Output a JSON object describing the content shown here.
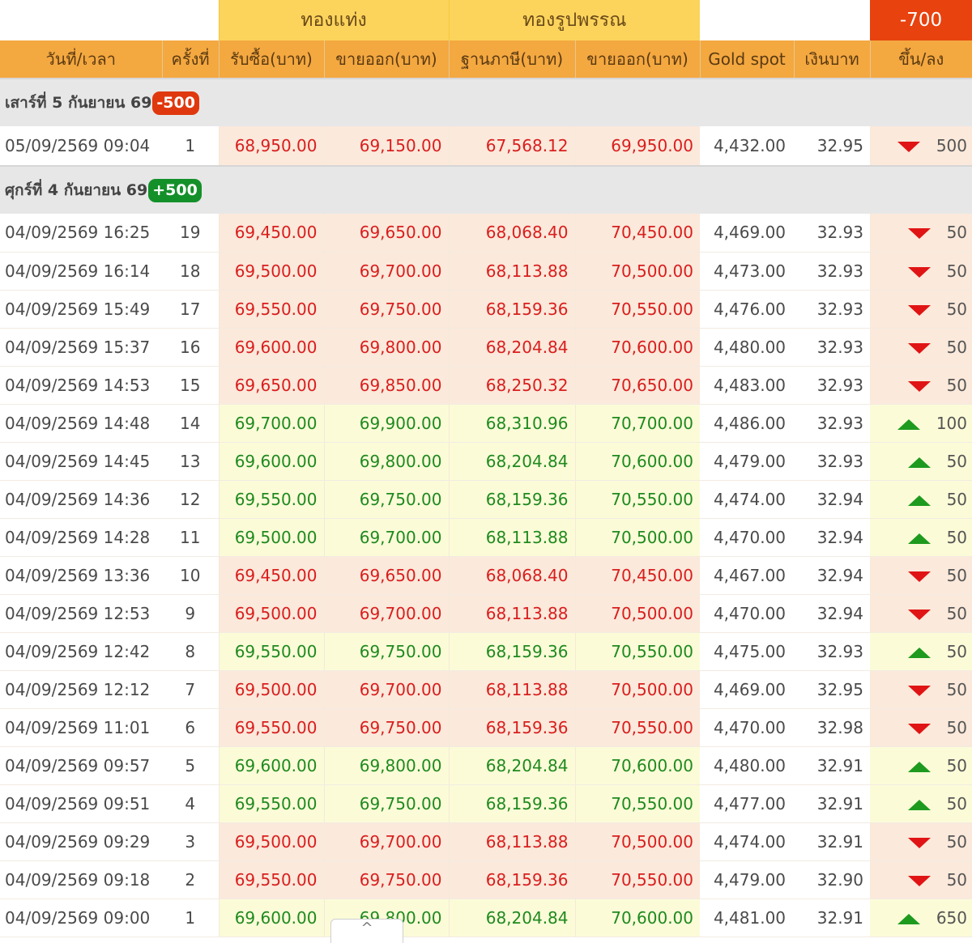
{
  "header": {
    "bar_group": "ทองแท่ง",
    "ornament_group": "ทองรูปพรรณ",
    "total_change": "-700"
  },
  "columns": [
    "วันที่/เวลา",
    "ครั้งที่",
    "รับซื้อ(บาท)",
    "ขายออก(บาท)",
    "ฐานภาษี(บาท)",
    "ขายออก(บาท)",
    "Gold spot",
    "เงินบาท",
    "ขึ้น/ลง"
  ],
  "days": [
    {
      "label": "เสาร์ที่ 5 กันยายน 69",
      "badge": "-500",
      "badge_trend": "down",
      "rows": [
        {
          "dt": "05/09/2569 09:04",
          "n": "1",
          "bar_buy": "68,950.00",
          "bar_sell": "69,150.00",
          "orn_tax": "67,568.12",
          "orn_sell": "69,950.00",
          "spot": "4,432.00",
          "thb": "32.95",
          "trend": "down",
          "change": "500"
        }
      ]
    },
    {
      "label": "ศุกร์ที่ 4 กันยายน 69",
      "badge": "+500",
      "badge_trend": "up",
      "rows": [
        {
          "dt": "04/09/2569 16:25",
          "n": "19",
          "bar_buy": "69,450.00",
          "bar_sell": "69,650.00",
          "orn_tax": "68,068.40",
          "orn_sell": "70,450.00",
          "spot": "4,469.00",
          "thb": "32.93",
          "trend": "down",
          "change": "50"
        },
        {
          "dt": "04/09/2569 16:14",
          "n": "18",
          "bar_buy": "69,500.00",
          "bar_sell": "69,700.00",
          "orn_tax": "68,113.88",
          "orn_sell": "70,500.00",
          "spot": "4,473.00",
          "thb": "32.93",
          "trend": "down",
          "change": "50"
        },
        {
          "dt": "04/09/2569 15:49",
          "n": "17",
          "bar_buy": "69,550.00",
          "bar_sell": "69,750.00",
          "orn_tax": "68,159.36",
          "orn_sell": "70,550.00",
          "spot": "4,476.00",
          "thb": "32.93",
          "trend": "down",
          "change": "50"
        },
        {
          "dt": "04/09/2569 15:37",
          "n": "16",
          "bar_buy": "69,600.00",
          "bar_sell": "69,800.00",
          "orn_tax": "68,204.84",
          "orn_sell": "70,600.00",
          "spot": "4,480.00",
          "thb": "32.93",
          "trend": "down",
          "change": "50"
        },
        {
          "dt": "04/09/2569 14:53",
          "n": "15",
          "bar_buy": "69,650.00",
          "bar_sell": "69,850.00",
          "orn_tax": "68,250.32",
          "orn_sell": "70,650.00",
          "spot": "4,483.00",
          "thb": "32.93",
          "trend": "down",
          "change": "50"
        },
        {
          "dt": "04/09/2569 14:48",
          "n": "14",
          "bar_buy": "69,700.00",
          "bar_sell": "69,900.00",
          "orn_tax": "68,310.96",
          "orn_sell": "70,700.00",
          "spot": "4,486.00",
          "thb": "32.93",
          "trend": "up",
          "change": "100"
        },
        {
          "dt": "04/09/2569 14:45",
          "n": "13",
          "bar_buy": "69,600.00",
          "bar_sell": "69,800.00",
          "orn_tax": "68,204.84",
          "orn_sell": "70,600.00",
          "spot": "4,479.00",
          "thb": "32.93",
          "trend": "up",
          "change": "50"
        },
        {
          "dt": "04/09/2569 14:36",
          "n": "12",
          "bar_buy": "69,550.00",
          "bar_sell": "69,750.00",
          "orn_tax": "68,159.36",
          "orn_sell": "70,550.00",
          "spot": "4,474.00",
          "thb": "32.94",
          "trend": "up",
          "change": "50"
        },
        {
          "dt": "04/09/2569 14:28",
          "n": "11",
          "bar_buy": "69,500.00",
          "bar_sell": "69,700.00",
          "orn_tax": "68,113.88",
          "orn_sell": "70,500.00",
          "spot": "4,470.00",
          "thb": "32.94",
          "trend": "up",
          "change": "50"
        },
        {
          "dt": "04/09/2569 13:36",
          "n": "10",
          "bar_buy": "69,450.00",
          "bar_sell": "69,650.00",
          "orn_tax": "68,068.40",
          "orn_sell": "70,450.00",
          "spot": "4,467.00",
          "thb": "32.94",
          "trend": "down",
          "change": "50"
        },
        {
          "dt": "04/09/2569 12:53",
          "n": "9",
          "bar_buy": "69,500.00",
          "bar_sell": "69,700.00",
          "orn_tax": "68,113.88",
          "orn_sell": "70,500.00",
          "spot": "4,470.00",
          "thb": "32.94",
          "trend": "down",
          "change": "50"
        },
        {
          "dt": "04/09/2569 12:42",
          "n": "8",
          "bar_buy": "69,550.00",
          "bar_sell": "69,750.00",
          "orn_tax": "68,159.36",
          "orn_sell": "70,550.00",
          "spot": "4,475.00",
          "thb": "32.93",
          "trend": "up",
          "change": "50"
        },
        {
          "dt": "04/09/2569 12:12",
          "n": "7",
          "bar_buy": "69,500.00",
          "bar_sell": "69,700.00",
          "orn_tax": "68,113.88",
          "orn_sell": "70,500.00",
          "spot": "4,469.00",
          "thb": "32.95",
          "trend": "down",
          "change": "50"
        },
        {
          "dt": "04/09/2569 11:01",
          "n": "6",
          "bar_buy": "69,550.00",
          "bar_sell": "69,750.00",
          "orn_tax": "68,159.36",
          "orn_sell": "70,550.00",
          "spot": "4,470.00",
          "thb": "32.98",
          "trend": "down",
          "change": "50"
        },
        {
          "dt": "04/09/2569 09:57",
          "n": "5",
          "bar_buy": "69,600.00",
          "bar_sell": "69,800.00",
          "orn_tax": "68,204.84",
          "orn_sell": "70,600.00",
          "spot": "4,480.00",
          "thb": "32.91",
          "trend": "up",
          "change": "50"
        },
        {
          "dt": "04/09/2569 09:51",
          "n": "4",
          "bar_buy": "69,550.00",
          "bar_sell": "69,750.00",
          "orn_tax": "68,159.36",
          "orn_sell": "70,550.00",
          "spot": "4,477.00",
          "thb": "32.91",
          "trend": "up",
          "change": "50"
        },
        {
          "dt": "04/09/2569 09:29",
          "n": "3",
          "bar_buy": "69,500.00",
          "bar_sell": "69,700.00",
          "orn_tax": "68,113.88",
          "orn_sell": "70,500.00",
          "spot": "4,474.00",
          "thb": "32.91",
          "trend": "down",
          "change": "50"
        },
        {
          "dt": "04/09/2569 09:18",
          "n": "2",
          "bar_buy": "69,550.00",
          "bar_sell": "69,750.00",
          "orn_tax": "68,159.36",
          "orn_sell": "70,550.00",
          "spot": "4,479.00",
          "thb": "32.90",
          "trend": "down",
          "change": "50"
        },
        {
          "dt": "04/09/2569 09:00",
          "n": "1",
          "bar_buy": "69,600.00",
          "bar_sell": "69,800.00",
          "orn_tax": "68,204.84",
          "orn_sell": "70,600.00",
          "spot": "4,481.00",
          "thb": "32.91",
          "trend": "up",
          "change": "650"
        }
      ]
    }
  ],
  "scroll_tab": {
    "icon": "chevron-up-icon",
    "glyph": "^"
  },
  "colors": {
    "header_yellow": "#fcd45c",
    "header_orange": "#f4a840",
    "total_red": "#e8420f",
    "price_down": "#d91e1e",
    "price_up": "#1f8a1f",
    "row_down_bg": "#fbe9db",
    "row_up_bg": "#fbfbd8",
    "badge_down": "#e0380e",
    "badge_up": "#14902a"
  }
}
